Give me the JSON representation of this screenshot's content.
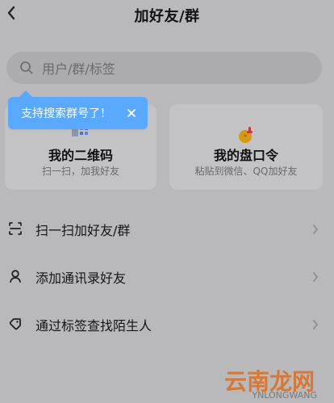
{
  "header": {
    "title": "加好友/群",
    "back_icon": "chevron-left-icon"
  },
  "search": {
    "icon": "search-icon",
    "placeholder": "用户/群/标签"
  },
  "tooltip": {
    "text": "支持搜索群号了！",
    "close_icon": "close-icon"
  },
  "cards": [
    {
      "icon": "qr-code-icon",
      "title": "我的二维码",
      "subtitle": "扫一扫，加我好友"
    },
    {
      "icon": "medal-icon",
      "title": "我的盘口令",
      "subtitle": "粘贴到微信、QQ加好友"
    }
  ],
  "list": [
    {
      "icon": "scan-icon",
      "label": "扫一扫加好友/群"
    },
    {
      "icon": "user-icon",
      "label": "添加通讯录好友"
    },
    {
      "icon": "tag-icon",
      "label": "通过标签查找陌生人"
    }
  ],
  "watermark": {
    "text": "云南龙网",
    "sub": "YNLONGWANG"
  },
  "colors": {
    "accent": "#59a9ff",
    "watermark": "#d77836"
  }
}
